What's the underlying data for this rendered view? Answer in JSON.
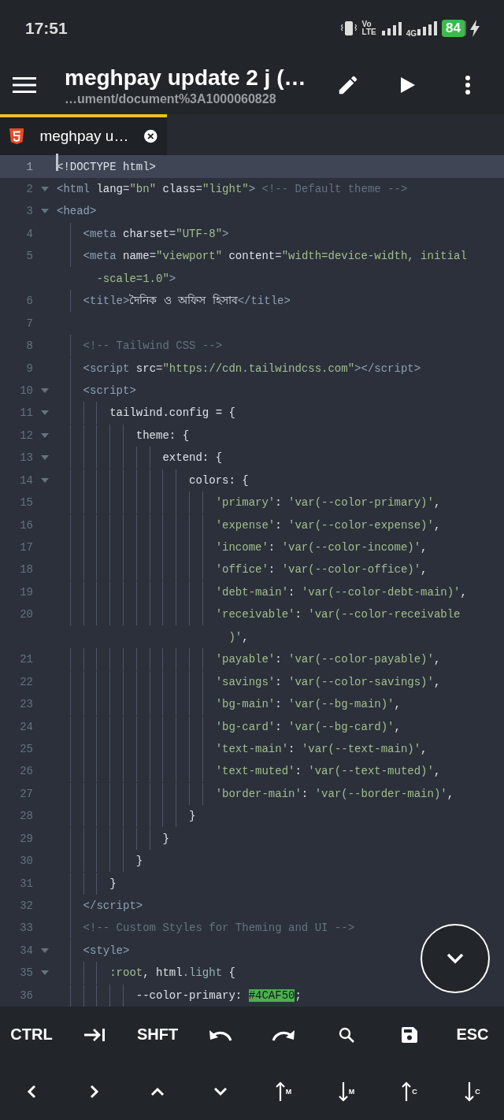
{
  "status_bar": {
    "time": "17:51",
    "network_labels": [
      "Vo",
      "LTE",
      "4G"
    ],
    "battery": "84",
    "charging": true
  },
  "toolbar": {
    "title": "meghpay update 2 j (…",
    "subtitle": "…ument/document%3A1000060828"
  },
  "tabs": [
    {
      "label": "meghpay u…",
      "selected": true
    }
  ],
  "editor": {
    "lines": [
      {
        "number": "1",
        "current": true,
        "foldable": false,
        "tokens": [
          {
            "text": "<!DOCTYPE html>",
            "kind": "plain"
          }
        ]
      },
      {
        "number": "2",
        "current": false,
        "foldable": true,
        "tokens": [
          {
            "text": "<html",
            "kind": "tag"
          },
          {
            "text": " lang",
            "kind": "attr"
          },
          {
            "text": "=",
            "kind": "punct"
          },
          {
            "text": "\"bn\"",
            "kind": "string"
          },
          {
            "text": " class",
            "kind": "attr"
          },
          {
            "text": "=",
            "kind": "punct"
          },
          {
            "text": "\"light\"",
            "kind": "string"
          },
          {
            "text": "> ",
            "kind": "tag"
          },
          {
            "text": "<!-- Default theme -->",
            "kind": "comment"
          }
        ]
      },
      {
        "number": "3",
        "current": false,
        "foldable": true,
        "tokens": [
          {
            "text": "<head>",
            "kind": "tag"
          }
        ]
      },
      {
        "number": "4",
        "current": false,
        "foldable": false,
        "tokens": [
          {
            "text": "    <meta",
            "kind": "tag"
          },
          {
            "text": " charset",
            "kind": "attr"
          },
          {
            "text": "=",
            "kind": "punct"
          },
          {
            "text": "\"UTF-8\"",
            "kind": "string"
          },
          {
            "text": ">",
            "kind": "tag"
          }
        ]
      },
      {
        "number": "5",
        "current": false,
        "foldable": false,
        "tokens": [
          {
            "text": "    <meta",
            "kind": "tag"
          },
          {
            "text": " name",
            "kind": "attr"
          },
          {
            "text": "=",
            "kind": "punct"
          },
          {
            "text": "\"viewport\"",
            "kind": "string"
          },
          {
            "text": " content",
            "kind": "attr"
          },
          {
            "text": "=",
            "kind": "punct"
          },
          {
            "text": "\"width=device-width, initial",
            "kind": "string"
          }
        ],
        "wrap": [
          {
            "text": "-scale=1.0\"",
            "kind": "string"
          },
          {
            "text": ">",
            "kind": "tag"
          }
        ]
      },
      {
        "number": "6",
        "current": false,
        "foldable": false,
        "tokens": [
          {
            "text": "    <title>",
            "kind": "tag"
          },
          {
            "text": "দৈনিক ও অফিস হিসাব",
            "kind": "plain"
          },
          {
            "text": "</title>",
            "kind": "tag"
          }
        ]
      },
      {
        "number": "7",
        "current": false,
        "foldable": false
      },
      {
        "number": "8",
        "current": false,
        "foldable": false,
        "tokens": [
          {
            "text": "    <!-- Tailwind CSS -->",
            "kind": "comment"
          }
        ]
      },
      {
        "number": "9",
        "current": false,
        "foldable": false,
        "tokens": [
          {
            "text": "    <script",
            "kind": "tag"
          },
          {
            "text": " src",
            "kind": "attr"
          },
          {
            "text": "=",
            "kind": "punct"
          },
          {
            "text": "\"https://cdn.tailwindcss.com\"",
            "kind": "string"
          },
          {
            "text": "></script>",
            "kind": "tag"
          }
        ]
      },
      {
        "number": "10",
        "current": false,
        "foldable": true,
        "tokens": [
          {
            "text": "    <script>",
            "kind": "tag"
          }
        ]
      },
      {
        "number": "11",
        "current": false,
        "foldable": true,
        "tokens": [
          {
            "text": "        tailwind.config = {",
            "kind": "plain"
          }
        ]
      },
      {
        "number": "12",
        "current": false,
        "foldable": true,
        "tokens": [
          {
            "text": "            theme: {",
            "kind": "plain"
          }
        ]
      },
      {
        "number": "13",
        "current": false,
        "foldable": true,
        "tokens": [
          {
            "text": "                extend: {",
            "kind": "plain"
          }
        ]
      },
      {
        "number": "14",
        "current": false,
        "foldable": true,
        "tokens": [
          {
            "text": "                    colors: {",
            "kind": "plain"
          }
        ]
      },
      {
        "number": "15",
        "current": false,
        "foldable": false,
        "tokens": [
          {
            "text": "                        'primary'",
            "kind": "string"
          },
          {
            "text": ": ",
            "kind": "plain"
          },
          {
            "text": "'var(--color-primary)'",
            "kind": "string"
          },
          {
            "text": ",",
            "kind": "plain"
          }
        ]
      },
      {
        "number": "16",
        "current": false,
        "foldable": false,
        "tokens": [
          {
            "text": "                        'expense'",
            "kind": "string"
          },
          {
            "text": ": ",
            "kind": "plain"
          },
          {
            "text": "'var(--color-expense)'",
            "kind": "string"
          },
          {
            "text": ",",
            "kind": "plain"
          }
        ]
      },
      {
        "number": "17",
        "current": false,
        "foldable": false,
        "tokens": [
          {
            "text": "                        'income'",
            "kind": "string"
          },
          {
            "text": ": ",
            "kind": "plain"
          },
          {
            "text": "'var(--color-income)'",
            "kind": "string"
          },
          {
            "text": ",",
            "kind": "plain"
          }
        ]
      },
      {
        "number": "18",
        "current": false,
        "foldable": false,
        "tokens": [
          {
            "text": "                        'office'",
            "kind": "string"
          },
          {
            "text": ": ",
            "kind": "plain"
          },
          {
            "text": "'var(--color-office)'",
            "kind": "string"
          },
          {
            "text": ",",
            "kind": "plain"
          }
        ]
      },
      {
        "number": "19",
        "current": false,
        "foldable": false,
        "tokens": [
          {
            "text": "                        'debt-main'",
            "kind": "string"
          },
          {
            "text": ": ",
            "kind": "plain"
          },
          {
            "text": "'var(--color-debt-main)'",
            "kind": "string"
          },
          {
            "text": ",",
            "kind": "plain"
          }
        ]
      },
      {
        "number": "20",
        "current": false,
        "foldable": false,
        "tokens": [
          {
            "text": "                        'receivable'",
            "kind": "string"
          },
          {
            "text": ": ",
            "kind": "plain"
          },
          {
            "text": "'var(--color-receivable",
            "kind": "string"
          }
        ],
        "wrap": [
          {
            "text": ")'",
            "kind": "string"
          },
          {
            "text": ",",
            "kind": "plain"
          }
        ]
      },
      {
        "number": "21",
        "current": false,
        "foldable": false,
        "tokens": [
          {
            "text": "                        'payable'",
            "kind": "string"
          },
          {
            "text": ": ",
            "kind": "plain"
          },
          {
            "text": "'var(--color-payable)'",
            "kind": "string"
          },
          {
            "text": ",",
            "kind": "plain"
          }
        ]
      },
      {
        "number": "22",
        "current": false,
        "foldable": false,
        "tokens": [
          {
            "text": "                        'savings'",
            "kind": "string"
          },
          {
            "text": ": ",
            "kind": "plain"
          },
          {
            "text": "'var(--color-savings)'",
            "kind": "string"
          },
          {
            "text": ",",
            "kind": "plain"
          }
        ]
      },
      {
        "number": "23",
        "current": false,
        "foldable": false,
        "tokens": [
          {
            "text": "                        'bg-main'",
            "kind": "string"
          },
          {
            "text": ": ",
            "kind": "plain"
          },
          {
            "text": "'var(--bg-main)'",
            "kind": "string"
          },
          {
            "text": ",",
            "kind": "plain"
          }
        ]
      },
      {
        "number": "24",
        "current": false,
        "foldable": false,
        "tokens": [
          {
            "text": "                        'bg-card'",
            "kind": "string"
          },
          {
            "text": ": ",
            "kind": "plain"
          },
          {
            "text": "'var(--bg-card)'",
            "kind": "string"
          },
          {
            "text": ",",
            "kind": "plain"
          }
        ]
      },
      {
        "number": "25",
        "current": false,
        "foldable": false,
        "tokens": [
          {
            "text": "                        'text-main'",
            "kind": "string"
          },
          {
            "text": ": ",
            "kind": "plain"
          },
          {
            "text": "'var(--text-main)'",
            "kind": "string"
          },
          {
            "text": ",",
            "kind": "plain"
          }
        ]
      },
      {
        "number": "26",
        "current": false,
        "foldable": false,
        "tokens": [
          {
            "text": "                        'text-muted'",
            "kind": "string"
          },
          {
            "text": ": ",
            "kind": "plain"
          },
          {
            "text": "'var(--text-muted)'",
            "kind": "string"
          },
          {
            "text": ",",
            "kind": "plain"
          }
        ]
      },
      {
        "number": "27",
        "current": false,
        "foldable": false,
        "tokens": [
          {
            "text": "                        'border-main'",
            "kind": "string"
          },
          {
            "text": ": ",
            "kind": "plain"
          },
          {
            "text": "'var(--border-main)'",
            "kind": "string"
          },
          {
            "text": ",",
            "kind": "plain"
          }
        ]
      },
      {
        "number": "28",
        "current": false,
        "foldable": false,
        "tokens": [
          {
            "text": "                    }",
            "kind": "plain"
          }
        ]
      },
      {
        "number": "29",
        "current": false,
        "foldable": false,
        "tokens": [
          {
            "text": "                }",
            "kind": "plain"
          }
        ]
      },
      {
        "number": "30",
        "current": false,
        "foldable": false,
        "tokens": [
          {
            "text": "            }",
            "kind": "plain"
          }
        ]
      },
      {
        "number": "31",
        "current": false,
        "foldable": false,
        "tokens": [
          {
            "text": "        }",
            "kind": "plain"
          }
        ]
      },
      {
        "number": "32",
        "current": false,
        "foldable": false,
        "tokens": [
          {
            "text": "    </script>",
            "kind": "tag"
          }
        ]
      },
      {
        "number": "33",
        "current": false,
        "foldable": false,
        "tokens": [
          {
            "text": "    <!-- Custom Styles for Theming and UI -->",
            "kind": "comment"
          }
        ]
      },
      {
        "number": "34",
        "current": false,
        "foldable": true,
        "tokens": [
          {
            "text": "    <style>",
            "kind": "tag"
          }
        ]
      },
      {
        "number": "35",
        "current": false,
        "foldable": true,
        "tokens": [
          {
            "text": "        :root",
            "kind": "selector"
          },
          {
            "text": ", html",
            "kind": "plain"
          },
          {
            "text": ".light",
            "kind": "class"
          },
          {
            "text": " {",
            "kind": "plain"
          }
        ]
      },
      {
        "number": "36",
        "current": false,
        "foldable": false,
        "tokens": [
          {
            "text": "            --color-primary: ",
            "kind": "plain"
          },
          {
            "text": "#4CAF50",
            "kind": "color-literal"
          },
          {
            "text": ";",
            "kind": "plain"
          }
        ]
      }
    ]
  },
  "keys": [
    [
      {
        "kind": "text",
        "label": "CTRL"
      },
      {
        "kind": "tab"
      },
      {
        "kind": "text",
        "label": "SHFT"
      },
      {
        "kind": "undo"
      },
      {
        "kind": "redo"
      },
      {
        "kind": "search"
      },
      {
        "kind": "save"
      },
      {
        "kind": "text",
        "label": "ESC"
      }
    ],
    [
      {
        "kind": "left"
      },
      {
        "kind": "right"
      },
      {
        "kind": "up"
      },
      {
        "kind": "down"
      },
      {
        "kind": "jump-up",
        "label": "M"
      },
      {
        "kind": "jump-down",
        "label": "M"
      },
      {
        "kind": "jump-up",
        "label": "C"
      },
      {
        "kind": "jump-down",
        "label": "C"
      }
    ]
  ]
}
